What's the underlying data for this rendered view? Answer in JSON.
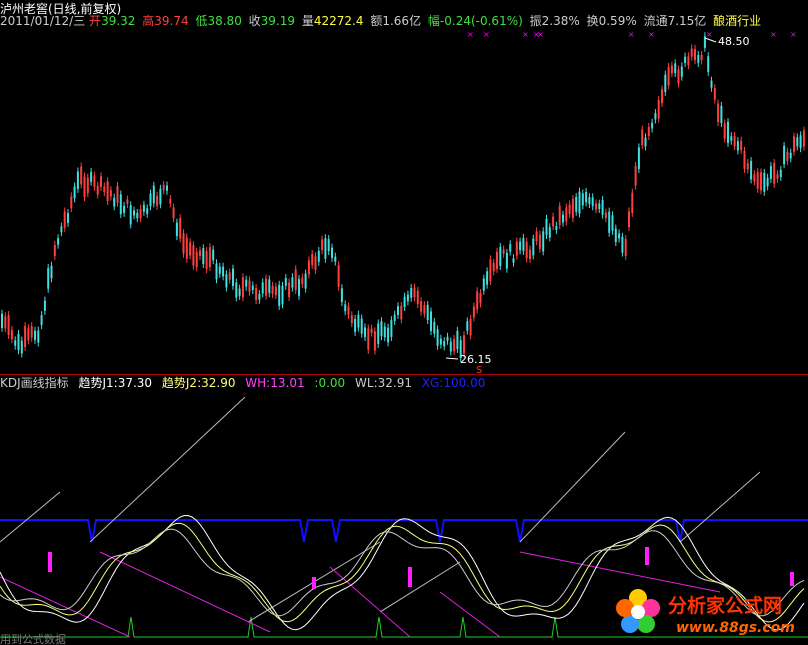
{
  "header": {
    "stock": "泸州老窖(日线,前复权)",
    "date": "2011/01/12/三",
    "open_label": "开",
    "open": "39.32",
    "high_label": "高",
    "high": "39.74",
    "low_label": "低",
    "low": "38.80",
    "close_label": "收",
    "close": "39.19",
    "vol_label": "量",
    "vol": "42272.4",
    "amt_label": "额",
    "amt": "1.66亿",
    "chg_label": "幅",
    "chg": "-0.24(-0.61%)",
    "amp_label": "振",
    "amp": "2.38%",
    "turn_label": "换",
    "turn": "0.59%",
    "float_label": "流通",
    "float": "7.15亿",
    "industry": "酿酒行业"
  },
  "price_chart": {
    "high_mark": "48.50",
    "low_mark": "26.15",
    "signal": "S"
  },
  "indicator": {
    "name": "KDJ画线指标",
    "j1_label": "趋势J1:",
    "j1": "37.30",
    "j2_label": "趋势J2:",
    "j2": "32.90",
    "wh_label": "WH:",
    "wh": "13.01",
    "zero_label": ":",
    "zero": "0.00",
    "wl_label": "WL:",
    "wl": "32.91",
    "xg_label": "XG:",
    "xg": "100.00"
  },
  "footer": "用到公式数据",
  "logo": {
    "title": "分析家公式网",
    "url": "www.88gs.com"
  },
  "colors": {
    "up": "#ff4040",
    "down": "#40e0e0",
    "bg": "#000000",
    "accent": "#ff00ff",
    "blue": "#0000ff"
  }
}
